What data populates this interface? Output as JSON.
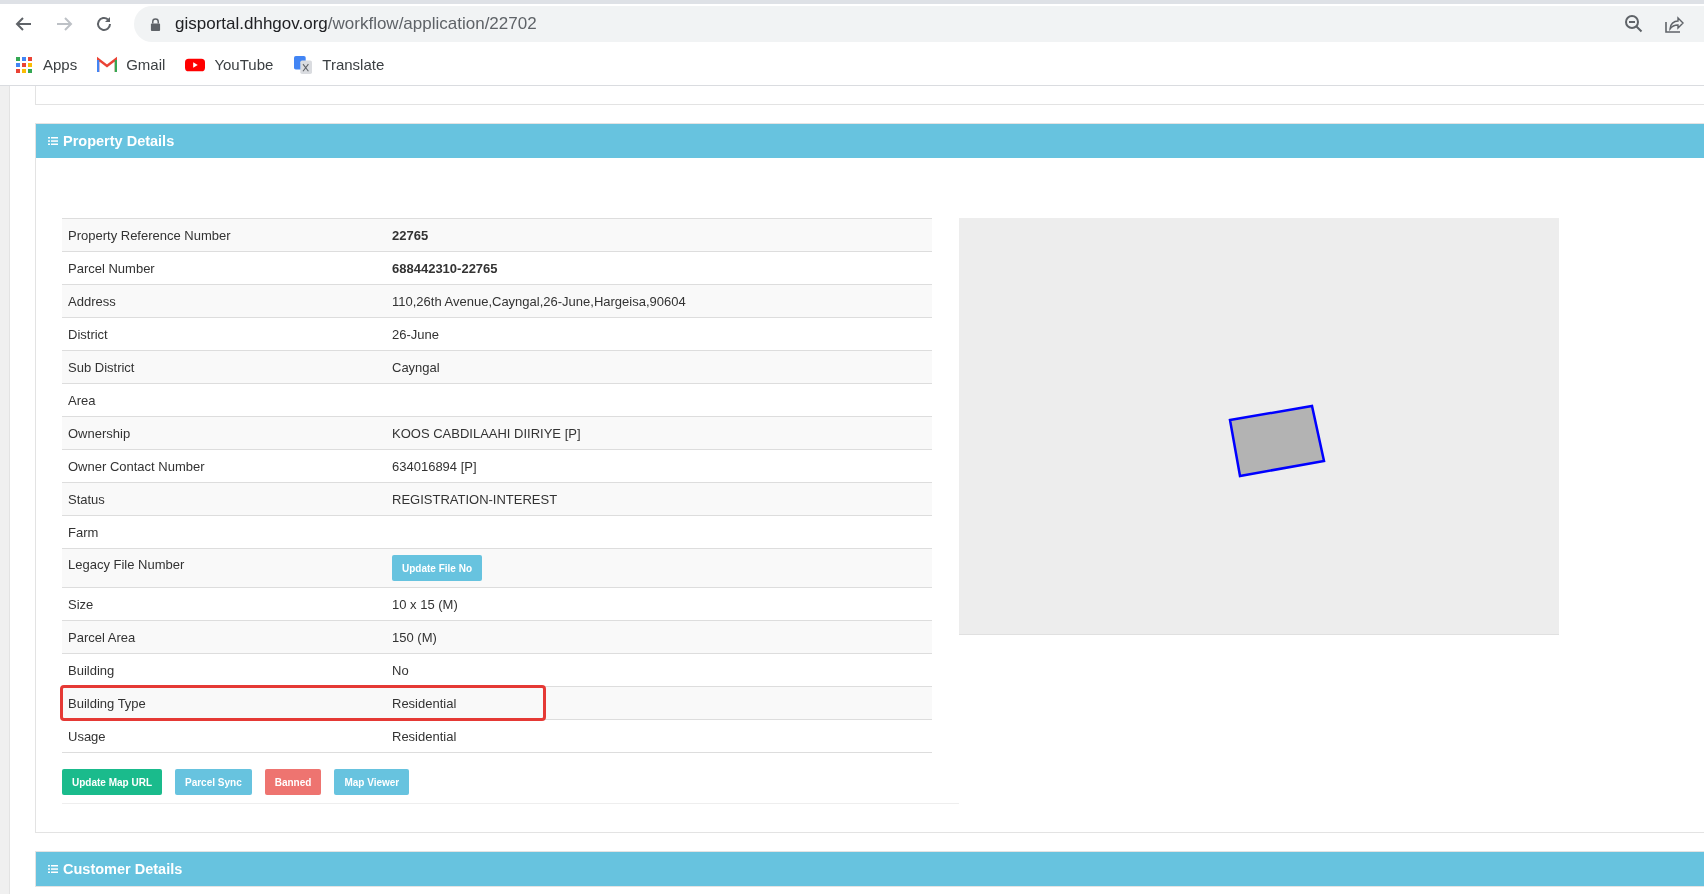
{
  "browser": {
    "url_host": "gisportal.dhhgov.org",
    "url_path": "/workflow/application/22702",
    "bookmarks": [
      {
        "label": "Apps",
        "kind": "apps"
      },
      {
        "label": "Gmail",
        "kind": "gmail"
      },
      {
        "label": "YouTube",
        "kind": "youtube"
      },
      {
        "label": "Translate",
        "kind": "translate"
      }
    ]
  },
  "property_panel": {
    "title": "Property Details",
    "rows": [
      {
        "label": "Property Reference Number",
        "value": "22765",
        "kind": "bold",
        "highlighted": false
      },
      {
        "label": "Parcel Number",
        "value": "688442310-22765",
        "kind": "bold",
        "highlighted": false
      },
      {
        "label": "Address",
        "value": "110,26th Avenue,Cayngal,26-June,Hargeisa,90604",
        "kind": "text",
        "highlighted": false
      },
      {
        "label": "District",
        "value": "26-June",
        "kind": "text",
        "highlighted": false
      },
      {
        "label": "Sub District",
        "value": "Cayngal",
        "kind": "text",
        "highlighted": false
      },
      {
        "label": "Area",
        "kind": "text",
        "highlighted": false
      },
      {
        "label": "Ownership",
        "value": "KOOS CABDILAAHI DIIRIYE [P]",
        "kind": "text",
        "highlighted": false
      },
      {
        "label": "Owner Contact Number",
        "value": "634016894 [P]",
        "kind": "text",
        "highlighted": false
      },
      {
        "label": "Status",
        "value": "REGISTRATION-INTEREST",
        "kind": "text",
        "highlighted": false
      },
      {
        "label": "Farm",
        "kind": "text",
        "highlighted": false
      },
      {
        "label": "Legacy File Number",
        "value": "Update File No",
        "kind": "button",
        "highlighted": false
      },
      {
        "label": "Size",
        "value": "10 x 15 (M)",
        "kind": "text",
        "highlighted": false
      },
      {
        "label": "Parcel Area",
        "value": "150 (M)",
        "kind": "text",
        "highlighted": false
      },
      {
        "label": "Building",
        "value": "No",
        "kind": "text",
        "highlighted": false
      },
      {
        "label": "Building Type",
        "value": "Residential",
        "kind": "text",
        "highlighted": true
      },
      {
        "label": "Usage",
        "value": "Residential",
        "kind": "text",
        "highlighted": false
      }
    ],
    "buttons": [
      {
        "label": "Update Map URL",
        "kind": "success"
      },
      {
        "label": "Parcel Sync",
        "kind": "info"
      },
      {
        "label": "Banned",
        "kind": "danger"
      },
      {
        "label": "Map Viewer",
        "kind": "info"
      }
    ]
  },
  "customer_panel": {
    "title": "Customer Details"
  }
}
